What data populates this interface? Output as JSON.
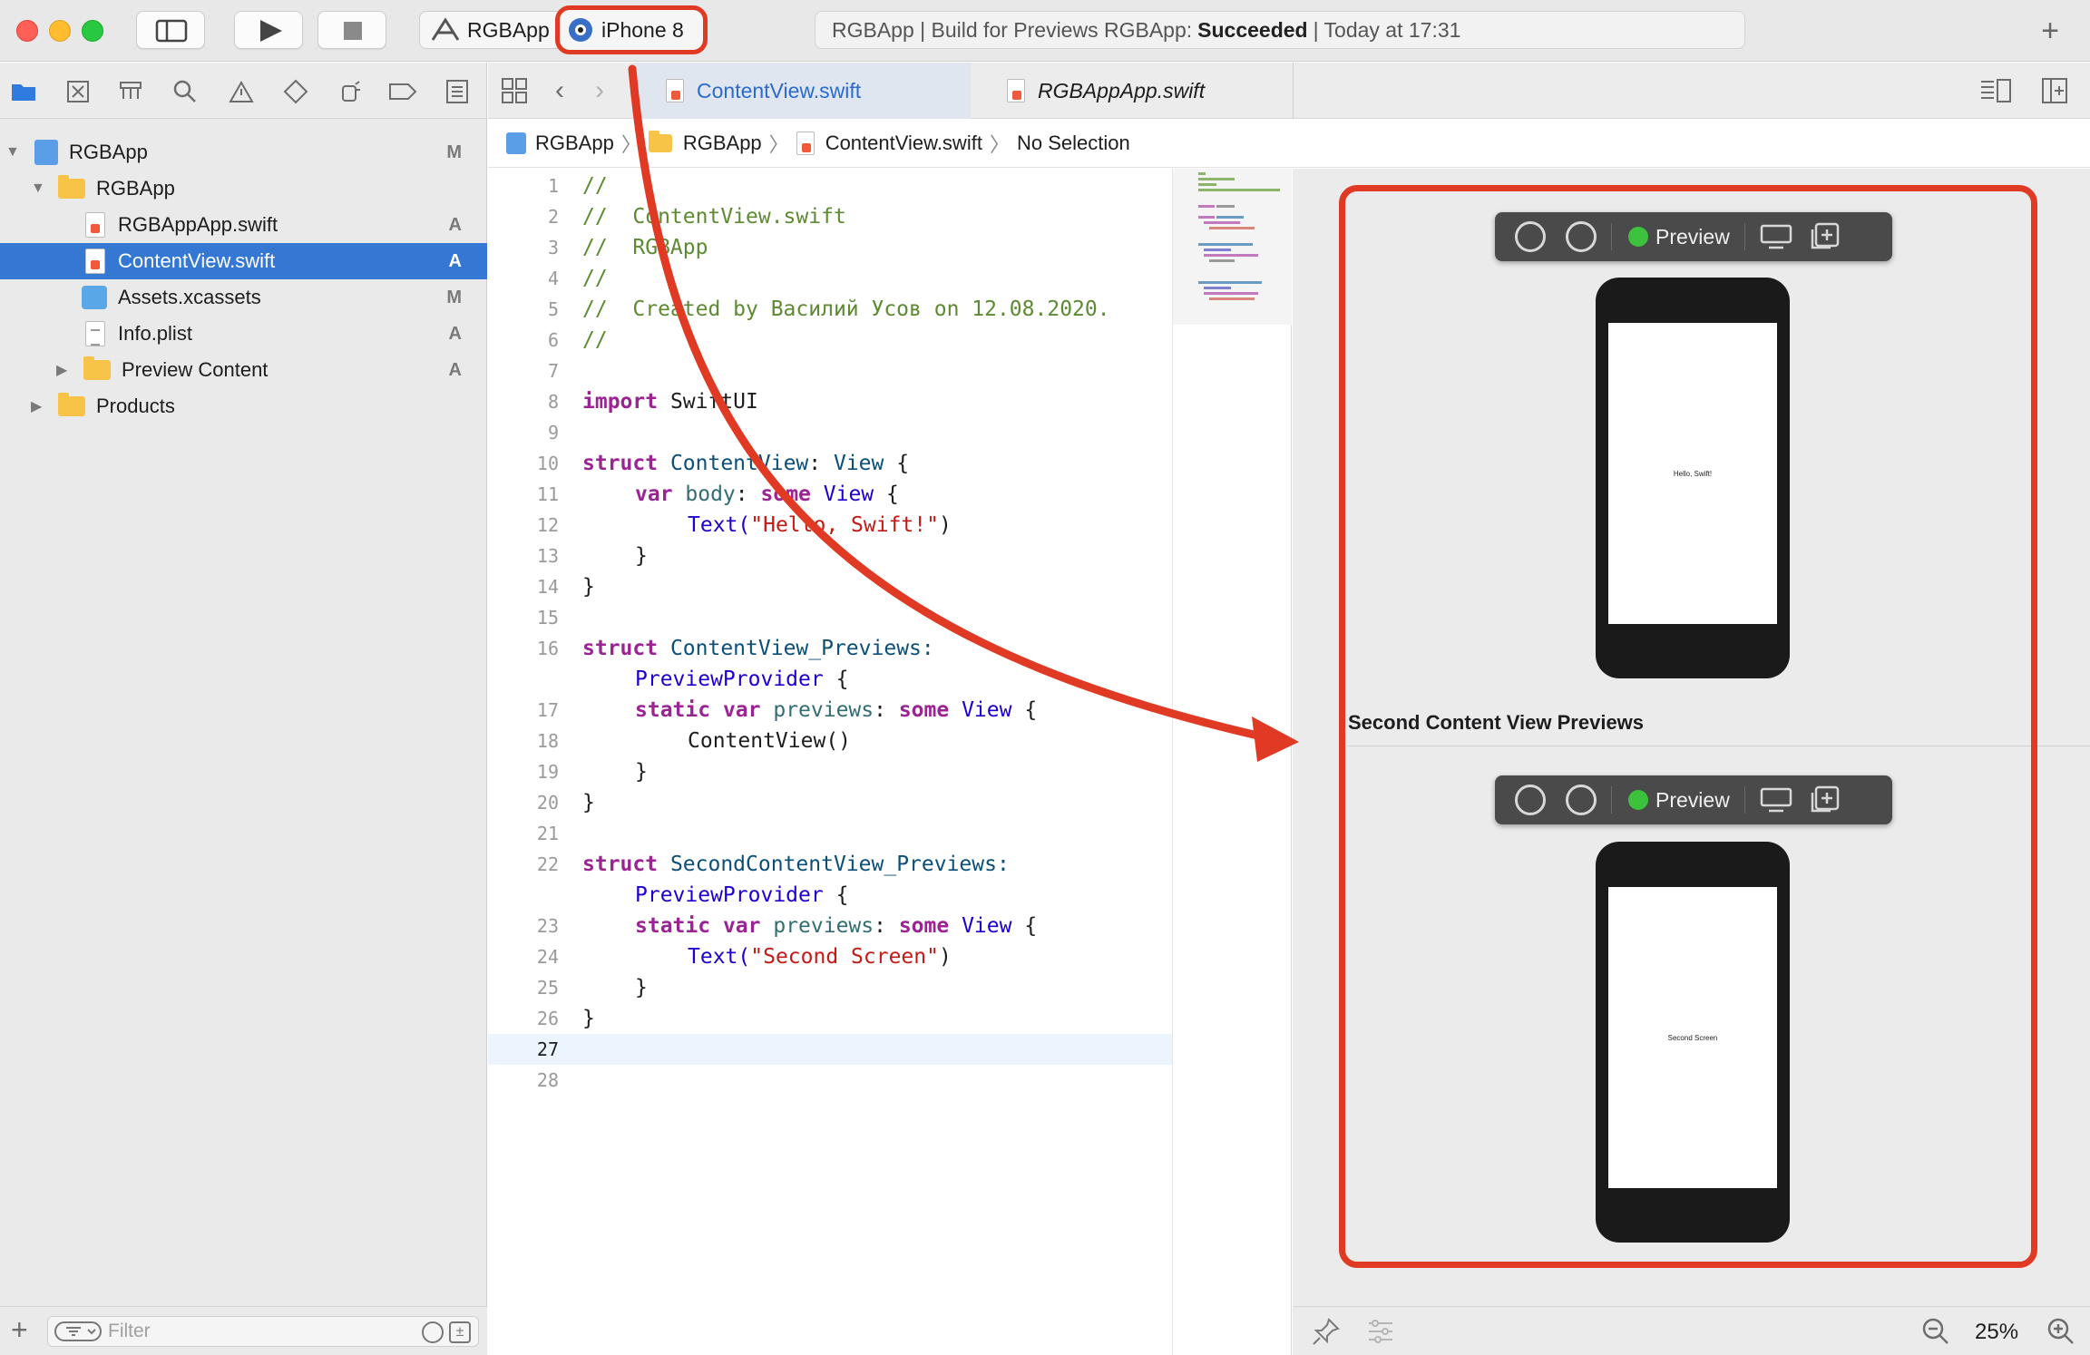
{
  "toolbar": {
    "scheme_name": "RGBApp",
    "device_name": "iPhone 8",
    "status_prefix": "RGBApp | Build for Previews RGBApp:",
    "status_result": "Succeeded",
    "status_time": "| Today at 17:31"
  },
  "sidebar": {
    "items": [
      {
        "label": "RGBApp",
        "badge": "M"
      },
      {
        "label": "RGBApp",
        "badge": ""
      },
      {
        "label": "RGBAppApp.swift",
        "badge": "A"
      },
      {
        "label": "ContentView.swift",
        "badge": "A"
      },
      {
        "label": "Assets.xcassets",
        "badge": "M"
      },
      {
        "label": "Info.plist",
        "badge": "A"
      },
      {
        "label": "Preview Content",
        "badge": "A"
      },
      {
        "label": "Products",
        "badge": ""
      }
    ],
    "filter_placeholder": "Filter"
  },
  "tabs": {
    "active": "ContentView.swift",
    "inactive": "RGBAppApp.swift"
  },
  "jumpbar": {
    "project": "RGBApp",
    "group": "RGBApp",
    "file": "ContentView.swift",
    "selection": "No Selection"
  },
  "editor": {
    "lines": [
      "1",
      "2",
      "3",
      "4",
      "5",
      "6",
      "7",
      "8",
      "9",
      "10",
      "11",
      "12",
      "13",
      "14",
      "15",
      "16",
      "",
      "17",
      "18",
      "19",
      "20",
      "21",
      "22",
      "",
      "23",
      "24",
      "25",
      "26",
      "27",
      "28"
    ],
    "code": {
      "c1": "//",
      "c2": "//  ContentView.swift",
      "c3": "//  RGBApp",
      "c4": "//",
      "c5": "//  Created by Василий Усов on 12.08.2020.",
      "c6": "//",
      "import_kw": "import",
      "import_mod": " SwiftUI",
      "struct_kw": "struct",
      "content_view": " ContentView",
      "colon_view": ": ",
      "view_type": "View",
      "brace_open": " {",
      "var_kw": "var",
      "body_id": " body",
      "colon_sp": ": ",
      "some_kw": "some",
      "text_call": "Text(",
      "hello_str": "\"Hello, Swift!\"",
      "paren_close": ")",
      "brace_close": "}",
      "previews_name": " ContentView_Previews:",
      "preview_provider": "PreviewProvider",
      "static_kw": "static",
      "previews_id": " previews",
      "content_view_call": "ContentView()",
      "second_previews_name": " SecondContentView_Previews:",
      "second_str": "\"Second Screen\""
    }
  },
  "preview": {
    "label": "Preview",
    "first_text": "Hello, Swift!",
    "section_title": "Second Content View Previews",
    "second_text": "Second Screen",
    "zoom": "25%"
  },
  "colors": {
    "accent": "#3478d4",
    "highlight": "#e03a24",
    "status_green": "#3cc23c"
  }
}
